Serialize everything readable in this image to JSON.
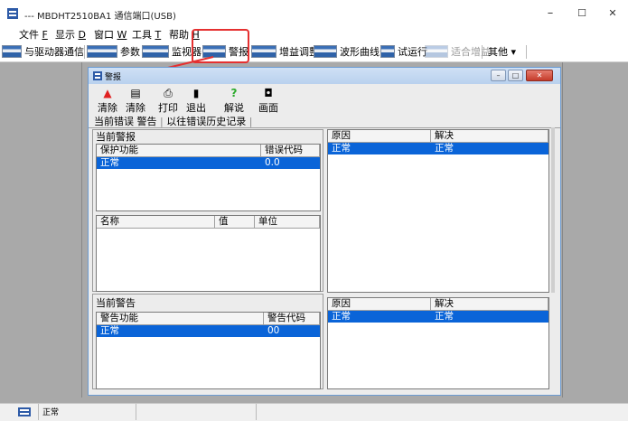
{
  "window": {
    "title": "--- MBDHT2510BA1 通信端口(USB)",
    "minimize": "–",
    "maximize": "☐",
    "close": "✕"
  },
  "menu": [
    {
      "label": "文件",
      "key": "F"
    },
    {
      "label": "显示",
      "key": "D"
    },
    {
      "label": "窗口",
      "key": "W"
    },
    {
      "label": "工具",
      "key": "T"
    },
    {
      "label": "帮助",
      "key": "H"
    }
  ],
  "toolbar": {
    "comm": "与驱动器通信",
    "params": "参数",
    "monitor": "监视器",
    "alarm": "警报",
    "gain": "增益调整",
    "waveform": "波形曲线",
    "trial": "试运行",
    "fitgain": "适合增益",
    "other": "其他 ▾"
  },
  "dialog": {
    "title": "警报",
    "buttons": {
      "clear": "清除",
      "clear2": "清除",
      "print": "打印",
      "exit": "退出",
      "solve": "解说",
      "screen": "画面"
    },
    "tabs": {
      "current": "当前错误 警告",
      "history": "以往错误历史记录"
    },
    "current_alarm": {
      "label": "当前警报",
      "headers": [
        "保护功能",
        "错误代码"
      ],
      "row": [
        "正常",
        "0.0"
      ]
    },
    "param_table": {
      "headers": [
        "名称",
        "值",
        "单位"
      ]
    },
    "alarm_cause": {
      "headers": [
        "原因",
        "解决"
      ],
      "row": [
        "正常",
        "正常"
      ]
    },
    "current_warning": {
      "label": "当前警告",
      "headers": [
        "警告功能",
        "警告代码"
      ],
      "row": [
        "正常",
        "00"
      ]
    },
    "warning_cause": {
      "headers": [
        "原因",
        "解决"
      ],
      "row": [
        "正常",
        "正常"
      ]
    }
  },
  "status": {
    "text": "正常"
  },
  "colors": {
    "selection": "#0a64d8",
    "highlight_box": "#e53030",
    "workspace": "#a9a9a9"
  }
}
